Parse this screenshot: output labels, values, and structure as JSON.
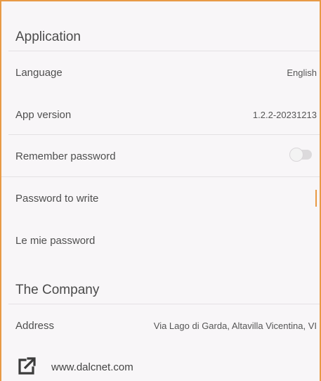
{
  "application": {
    "title": "Application",
    "language_label": "Language",
    "language_value": "English",
    "version_label": "App version",
    "version_value": "1.2.2-20231213",
    "remember_label": "Remember password",
    "remember_on": false,
    "password_write_label": "Password to write",
    "my_passwords_label": "Le mie password"
  },
  "company": {
    "title": "The Company",
    "address_label": "Address",
    "address_value": "Via Lago di Garda, Altavilla Vicentina, VI",
    "website_link": "www.dalcnet.com",
    "website_icon": "external-link-icon"
  },
  "colors": {
    "accent": "#e89a45"
  }
}
